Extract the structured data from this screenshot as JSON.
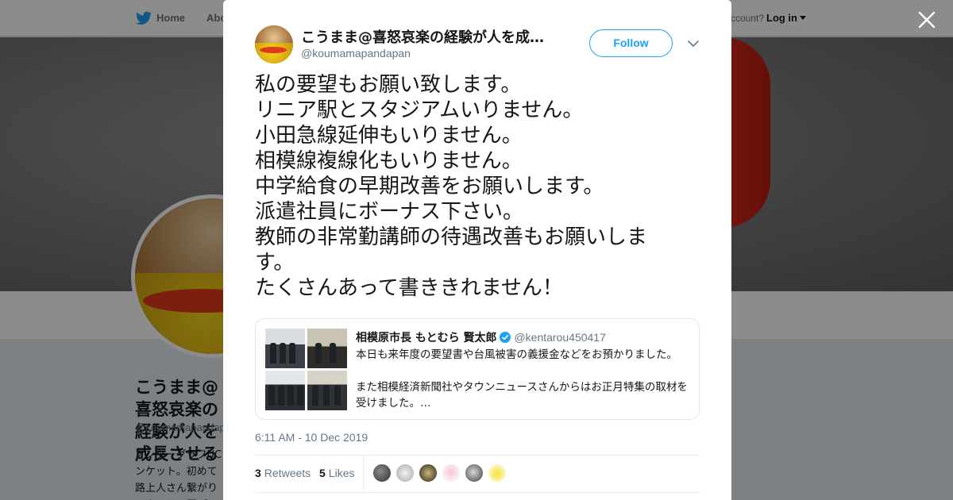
{
  "topbar": {
    "home_label": "Home",
    "about_label": "Abo",
    "account_text": "ccount?",
    "login_label": "Log in"
  },
  "profile": {
    "name": "こうまま@喜怒哀楽の経験が人を成長させる",
    "handle": "@koumamapandapan",
    "bio": "アンダーグラフUCンケット。初めて路上人さん繋がりハウスは町田プレ"
  },
  "tweet": {
    "author_name": "こうまま@喜怒哀楽の経験が人を成…",
    "author_handle": "@koumamapandapan",
    "follow_label": "Follow",
    "lines": [
      "私の要望もお願い致します。",
      "リニア駅とスタジアムいりません。",
      "小田急線延伸もいりません。",
      "相模線複線化もいりません。",
      "中学給食の早期改善をお願いします。",
      "派遣社員にボーナス下さい。",
      "教師の非常勤講師の待遇改善もお願いしま",
      "す。",
      "たくさんあって書ききれません！"
    ],
    "timestamp": "6:11 AM - 10 Dec 2019",
    "retweets_count": "3",
    "retweets_label": "Retweets",
    "likes_count": "5",
    "likes_label": "Likes"
  },
  "quote": {
    "author_name": "相模原市長 もとむら 賢太郎",
    "author_handle": "@kentarou450417",
    "text_p1": "本日も来年度の要望書や台風被害の義援金などをお預かりました。",
    "text_p2": "また相模経済新聞社やタウンニュースさんからはお正月特集の取材を受けました。…"
  },
  "colors": {
    "accent": "#1da1f2",
    "text": "#14171a",
    "muted": "#657786",
    "border": "#e1e8ed"
  },
  "icons": [
    "twitter-bird-icon",
    "close-icon",
    "chevron-down-icon",
    "verified-badge-icon"
  ]
}
